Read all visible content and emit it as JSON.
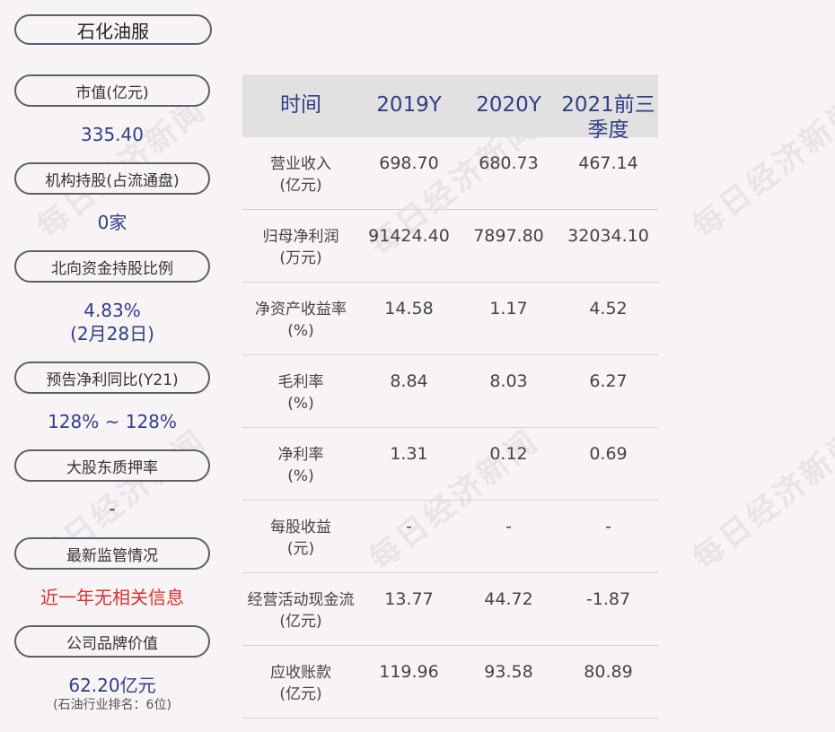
{
  "company": "石化油服",
  "watermark": "每日经济新闻",
  "metrics": [
    {
      "label": "市值(亿元)",
      "value": "335.40"
    },
    {
      "label": "机构持股(占流通盘)",
      "value": "0家"
    },
    {
      "label": "北向资金持股比例",
      "value": "4.83%",
      "value2": "(2月28日)"
    },
    {
      "label": "预告净利同比(Y21)",
      "value": "128% ~ 128%"
    },
    {
      "label": "大股东质押率",
      "value": "-"
    },
    {
      "label": "最新监管情况",
      "value": "近一年无相关信息"
    },
    {
      "label": "公司品牌价值",
      "value": "62.20亿元",
      "sub": "(石油行业排名：6位)"
    }
  ],
  "table": {
    "headers": [
      "时间",
      "2019Y",
      "2020Y",
      "2021前三季度"
    ],
    "rows": [
      {
        "label": "营业收入",
        "unit": "(亿元)",
        "values": [
          "698.70",
          "680.73",
          "467.14"
        ]
      },
      {
        "label": "归母净利润",
        "unit": "(万元)",
        "values": [
          "91424.40",
          "7897.80",
          "32034.10"
        ]
      },
      {
        "label": "净资产收益率",
        "unit": "(%)",
        "values": [
          "14.58",
          "1.17",
          "4.52"
        ]
      },
      {
        "label": "毛利率",
        "unit": "(%)",
        "values": [
          "8.84",
          "8.03",
          "6.27"
        ]
      },
      {
        "label": "净利率",
        "unit": "(%)",
        "values": [
          "1.31",
          "0.12",
          "0.69"
        ]
      },
      {
        "label": "每股收益",
        "unit": "(元)",
        "values": [
          "-",
          "-",
          "-"
        ]
      },
      {
        "label": "经营活动现金流",
        "unit": "(亿元)",
        "values": [
          "13.77",
          "44.72",
          "-1.87"
        ]
      },
      {
        "label": "应收账款",
        "unit": "(亿元)",
        "values": [
          "119.96",
          "93.58",
          "80.89"
        ]
      }
    ]
  },
  "colors": {
    "accent": "#2f3f86",
    "alert": "#d93030",
    "background": "#f8f3f4"
  }
}
